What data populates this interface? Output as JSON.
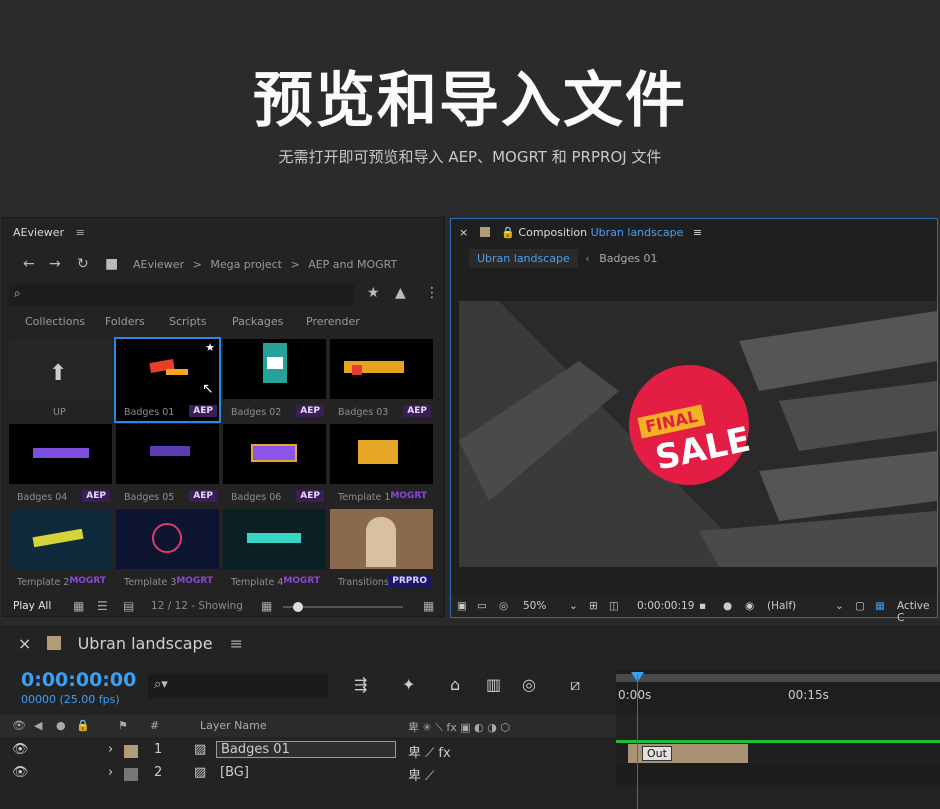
{
  "hero": {
    "title": "预览和导入文件",
    "subtitle": "无需打开即可预览和导入 AEP、MOGRT 和 PRPROJ 文件"
  },
  "aeviewer": {
    "title": "AEviewer",
    "breadcrumbs": [
      "AEviewer",
      ">",
      "Mega project",
      ">",
      "AEP and MOGRT"
    ],
    "tabs": [
      "Collections",
      "Folders",
      "Scripts",
      "Packages",
      "Prerender"
    ],
    "items": [
      {
        "label": "UP",
        "badge": ""
      },
      {
        "label": "Badges 01",
        "badge": "AEP"
      },
      {
        "label": "Badges 02",
        "badge": "AEP"
      },
      {
        "label": "Badges 03",
        "badge": "AEP"
      },
      {
        "label": "Badges 04",
        "badge": "AEP"
      },
      {
        "label": "Badges 05",
        "badge": "AEP"
      },
      {
        "label": "Badges 06",
        "badge": "AEP"
      },
      {
        "label": "Template 1",
        "badge": "MOGRT"
      },
      {
        "label": "Template 2",
        "badge": "MOGRT"
      },
      {
        "label": "Template 3",
        "badge": "MOGRT"
      },
      {
        "label": "Template 4",
        "badge": "MOGRT"
      },
      {
        "label": "Transitions te",
        "badge": "PRPRO"
      }
    ],
    "footer": {
      "play_all": "Play All",
      "showing": "12 / 12 - Showing"
    }
  },
  "composition": {
    "label": "Composition",
    "name": "Ubran landscape",
    "tab_active": "Ubran landscape",
    "tab_other": "Badges 01",
    "artwork": {
      "line1": "FINAL",
      "line2": "SALE"
    },
    "footer": {
      "zoom": "50%",
      "timecode": "0:00:00:19",
      "resolution": "(Half)",
      "camera": "Active C"
    }
  },
  "timeline": {
    "comp_name": "Ubran landscape",
    "current_time": "0:00:00:00",
    "fps": "00000 (25.00 fps)",
    "ruler_ticks": [
      "0:00s",
      "00:15s"
    ],
    "columns": {
      "num": "#",
      "layer_name": "Layer Name"
    },
    "layers": [
      {
        "num": "1",
        "name": "Badges 01"
      },
      {
        "num": "2",
        "name": "[BG]"
      }
    ],
    "clip_tag": "Out"
  },
  "colors": {
    "accent": "#3ba0f5",
    "panel": "#232323",
    "aep_badge": "#3a1e55",
    "mogrt": "#8a46d8",
    "sale_red": "#e31d44",
    "sale_yellow": "#f4b122"
  }
}
